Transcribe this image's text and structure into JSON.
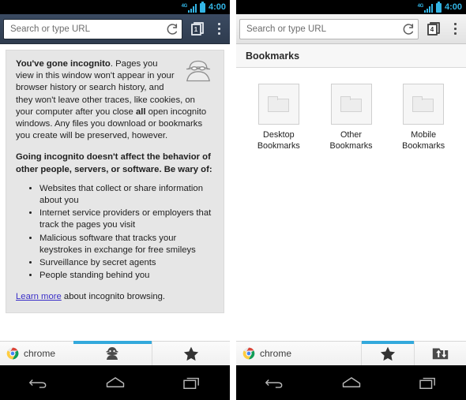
{
  "colors": {
    "status_accent": "#33b5e5",
    "tab_indicator": "#33a9dc",
    "incognito_toolbar": "#33404f",
    "normal_toolbar": "#eaeaea",
    "card_bg": "#e6e6e6",
    "link": "#3b30c8"
  },
  "left_phone": {
    "status_bar": {
      "network_label": "4G",
      "clock": "4:00",
      "signal_icon": "signal-bars-icon",
      "battery_icon": "battery-icon"
    },
    "toolbar": {
      "url_placeholder": "Search or type URL",
      "url_value": "",
      "reload_icon": "reload-icon",
      "tab_count": "1",
      "tabs_icon": "tab-stack-icon",
      "menu_icon": "overflow-menu-icon"
    },
    "incognito_card": {
      "spy_icon": "incognito-spy-icon",
      "para1_lead": "You've gone incognito",
      "para1_rest": ". Pages you view in this window won't appear in your browser history or search history, and they won't leave other traces, like cookies, on your computer after you close ",
      "para1_bold2": "all",
      "para1_tail": " open incognito windows. Any files you download or bookmarks you create will be preserved, however.",
      "para2": "Going incognito doesn't affect the behavior of other people, servers, or software. Be wary of:",
      "bullets": [
        "Websites that collect or share information about you",
        "Internet service providers or employers that track the pages you visit",
        "Malicious software that tracks your keystrokes in exchange for free smileys",
        "Surveillance by secret agents",
        "People standing behind you"
      ],
      "footer_link": "Learn more",
      "footer_rest": " about incognito browsing."
    },
    "chrome_bar": {
      "brand": "chrome",
      "brand_logo": "chrome-logo-icon",
      "tabs": [
        {
          "name": "tab-incognito",
          "icon": "incognito-spy-icon",
          "active": true
        },
        {
          "name": "tab-bookmarks",
          "icon": "star-icon",
          "active": false
        }
      ]
    },
    "nav_bar": {
      "back_icon": "back-arrow-icon",
      "home_icon": "home-icon",
      "recents_icon": "recent-apps-icon"
    }
  },
  "right_phone": {
    "status_bar": {
      "network_label": "4G",
      "clock": "4:00",
      "signal_icon": "signal-bars-icon",
      "battery_icon": "battery-icon"
    },
    "toolbar": {
      "url_placeholder": "Search or type URL",
      "url_value": "",
      "reload_icon": "reload-icon",
      "tab_count": "4",
      "tabs_icon": "tab-stack-icon",
      "menu_icon": "overflow-menu-icon"
    },
    "bookmarks": {
      "header_title": "Bookmarks",
      "folders": [
        {
          "label": "Desktop\nBookmarks",
          "line1": "Desktop",
          "line2": "Bookmarks",
          "icon": "folder-icon"
        },
        {
          "label": "Other Bookmarks",
          "line1": "Other",
          "line2": "Bookmarks",
          "icon": "folder-icon"
        },
        {
          "label": "Mobile Bookmarks",
          "line1": "Mobile",
          "line2": "Bookmarks",
          "icon": "folder-icon"
        }
      ]
    },
    "chrome_bar": {
      "brand": "chrome",
      "brand_logo": "chrome-logo-icon",
      "tabs": [
        {
          "name": "tab-most-visited",
          "icon": "grid-icon",
          "active": false
        },
        {
          "name": "tab-bookmarks",
          "icon": "star-icon",
          "active": true
        },
        {
          "name": "tab-other-devices",
          "icon": "sync-devices-icon",
          "active": false
        }
      ]
    },
    "nav_bar": {
      "back_icon": "back-arrow-icon",
      "home_icon": "home-icon",
      "recents_icon": "recent-apps-icon"
    }
  }
}
